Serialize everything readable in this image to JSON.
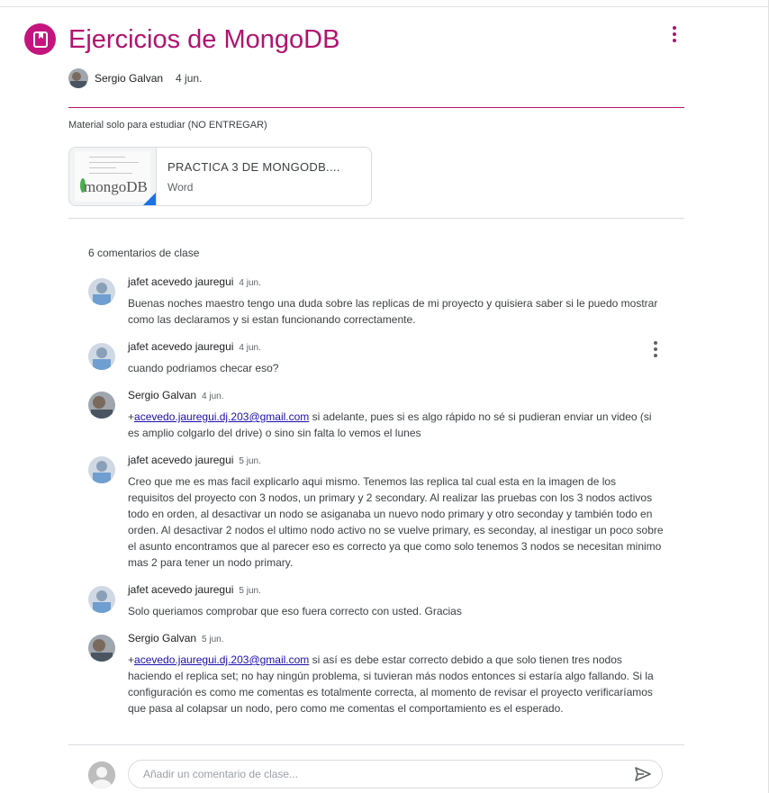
{
  "header": {
    "title": "Ejercicios de MongoDB",
    "author": "Sergio Galvan",
    "date": "4 jun.",
    "icon": "assignment-icon"
  },
  "description": "Material solo para estudiar (NO ENTREGAR)",
  "attachment": {
    "title": "PRACTICA 3 DE MONGODB....",
    "type": "Word",
    "thumb_logo": "mongoDB"
  },
  "comments_count": "6 comentarios de clase",
  "comments": [
    {
      "name": "jafet acevedo jauregui",
      "date": "4 jun.",
      "text": "Buenas noches maestro tengo una duda sobre las replicas de mi proyecto y quisiera saber si le puedo mostrar como las declaramos y si estan funcionando correctamente."
    },
    {
      "name": "jafet acevedo jauregui",
      "date": "4 jun.",
      "text": "cuando podriamos checar eso?"
    },
    {
      "name": "Sergio Galvan",
      "date": "4 jun.",
      "prefix": "+",
      "mention": "acevedo.jauregui.dj.203@gmail.com",
      "text": " si adelante, pues si es algo rápido no sé si pudieran enviar un video (si es amplio colgarlo del drive) o sino sin falta lo vemos el lunes"
    },
    {
      "name": "jafet acevedo jauregui",
      "date": "5 jun.",
      "text": "Creo que me es mas facil explicarlo aqui mismo. Tenemos las replica tal cual esta en la imagen de los requisitos del proyecto con 3 nodos, un primary y 2 secondary. Al realizar las pruebas con los 3 nodos activos todo en orden, al desactivar un nodo se asiganaba un nuevo nodo primary y otro seconday y también todo en orden. Al desactivar 2 nodos el ultimo nodo activo no se vuelve primary, es seconday, al inestigar un poco sobre el asunto encontramos que al parecer eso es correcto ya que como solo tenemos 3 nodos se necesitan minimo mas 2 para tener un nodo primary."
    },
    {
      "name": "jafet acevedo jauregui",
      "date": "5 jun.",
      "text": "Solo queriamos comprobar que eso fuera correcto con usted. Gracias"
    },
    {
      "name": "Sergio Galvan",
      "date": "5 jun.",
      "prefix": "+",
      "mention": "acevedo.jauregui.dj.203@gmail.com",
      "text": " si así es debe estar correcto debido a que solo tienen tres nodos haciendo el replica set; no hay ningún problema, si tuvieran más nodos entonces si estaría algo fallando. Si la configuración es como me comentas es totalmente correcta, al momento de revisar el proyecto verificaríamos que pasa al colapsar un nodo, pero como me comentas el comportamiento es el esperado."
    }
  ],
  "comment_input": {
    "placeholder": "Añadir un comentario de clase..."
  },
  "colors": {
    "accent": "#b0136f",
    "icon_bg": "#c4157f",
    "link": "#1a0dab"
  }
}
